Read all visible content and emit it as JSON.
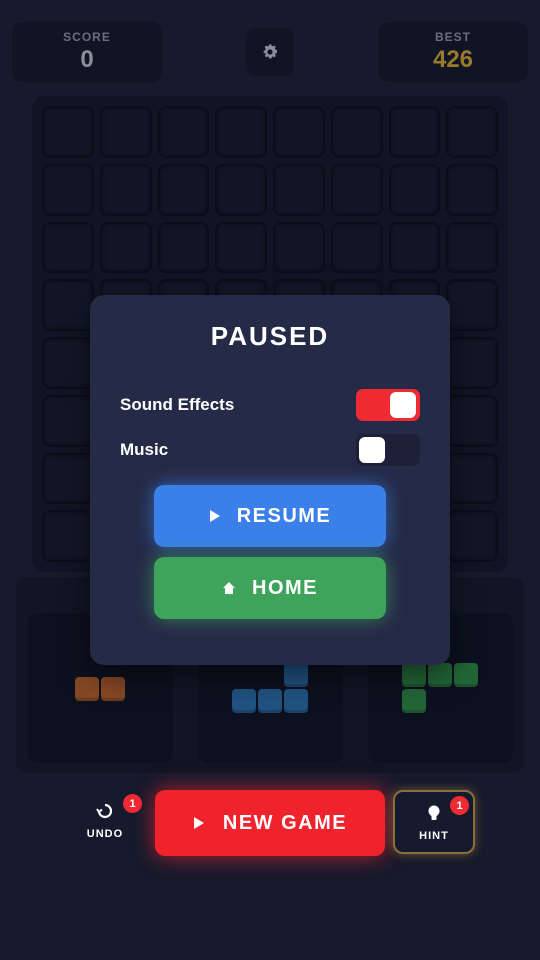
{
  "score": {
    "label": "SCORE",
    "value": "0"
  },
  "best": {
    "label": "BEST",
    "value": "426"
  },
  "settings": {
    "icon": "gear-icon"
  },
  "board": {
    "rows": 8,
    "cols": 8
  },
  "pause_menu": {
    "title": "PAUSED",
    "sound_effects": {
      "label": "Sound Effects",
      "enabled": true
    },
    "music": {
      "label": "Music",
      "enabled": false
    },
    "resume_label": "RESUME",
    "home_label": "HOME"
  },
  "pieces": [
    {
      "color": "#c9682a",
      "shape": "horizontal domino"
    },
    {
      "color": "#2d77b9",
      "shape": "L tetromino"
    },
    {
      "color": "#2f9546",
      "shape": "J tetromino"
    }
  ],
  "undo": {
    "label": "UNDO",
    "count": "1"
  },
  "new_game": {
    "label": "NEW GAME"
  },
  "hint": {
    "label": "HINT",
    "count": "1"
  },
  "colors": {
    "accent_red": "#ee2a33",
    "resume_blue": "#3a80e8",
    "home_green": "#3ea45c",
    "best_gold": "#e0b43a"
  }
}
